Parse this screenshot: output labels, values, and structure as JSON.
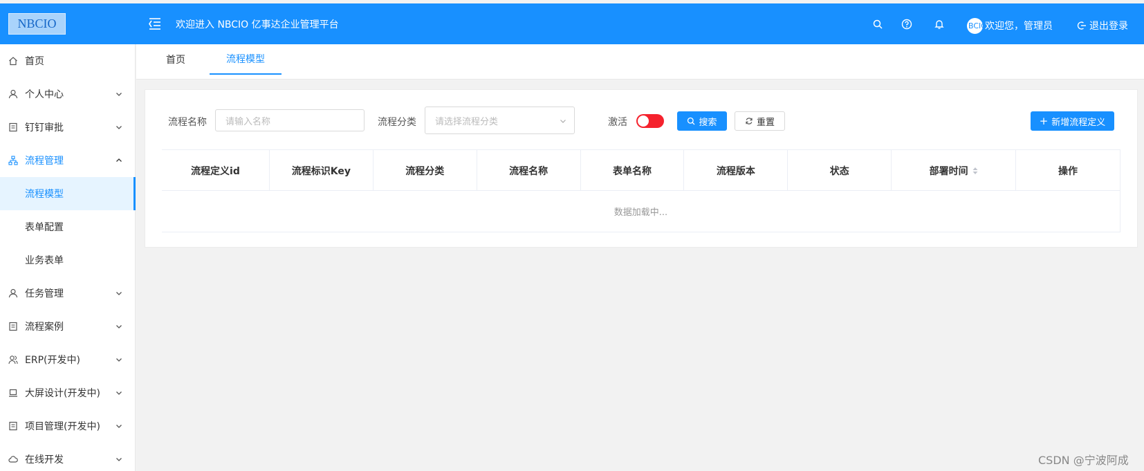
{
  "header": {
    "logo": "NBCIO",
    "title": "欢迎进入 NBCIO 亿事达企业管理平台",
    "avatar_text": "BCIO",
    "welcome": "欢迎您，管理员",
    "logout": "退出登录"
  },
  "sidebar": {
    "items": [
      {
        "label": "首页",
        "icon": "home-icon"
      },
      {
        "label": "个人中心",
        "icon": "user-icon"
      },
      {
        "label": "钉钉审批",
        "icon": "document-icon"
      },
      {
        "label": "流程管理",
        "icon": "sitemap-icon"
      },
      {
        "label": "流程模型"
      },
      {
        "label": "表单配置"
      },
      {
        "label": "业务表单"
      },
      {
        "label": "任务管理",
        "icon": "user-icon"
      },
      {
        "label": "流程案例",
        "icon": "document-icon"
      },
      {
        "label": "ERP(开发中)",
        "icon": "users-icon"
      },
      {
        "label": "大屏设计(开发中)",
        "icon": "laptop-icon"
      },
      {
        "label": "项目管理(开发中)",
        "icon": "document-icon"
      },
      {
        "label": "在线开发",
        "icon": "cloud-icon"
      }
    ]
  },
  "tabs": [
    {
      "label": "首页"
    },
    {
      "label": "流程模型"
    }
  ],
  "filters": {
    "name_label": "流程名称",
    "name_placeholder": "请输入名称",
    "category_label": "流程分类",
    "category_placeholder": "请选择流程分类",
    "active_label": "激活",
    "search_button": "搜索",
    "reset_button": "重置",
    "add_button": "新增流程定义"
  },
  "table": {
    "columns": [
      "流程定义id",
      "流程标识Key",
      "流程分类",
      "流程名称",
      "表单名称",
      "流程版本",
      "状态",
      "部署时间",
      "操作"
    ],
    "empty_text": "数据加载中..."
  },
  "watermark": "CSDN @宁波阿成",
  "colors": {
    "primary": "#1890ff",
    "toggle_off": "#f5222d"
  }
}
